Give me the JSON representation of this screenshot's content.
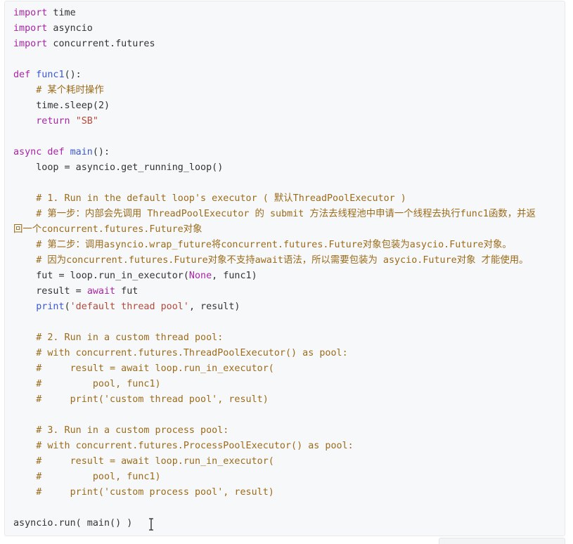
{
  "code": {
    "lines": [
      {
        "tokens": [
          {
            "t": "import",
            "c": "kw"
          },
          {
            "t": " time",
            "c": ""
          }
        ]
      },
      {
        "tokens": [
          {
            "t": "import",
            "c": "kw"
          },
          {
            "t": " asyncio",
            "c": ""
          }
        ]
      },
      {
        "tokens": [
          {
            "t": "import",
            "c": "kw"
          },
          {
            "t": " concurrent.futures",
            "c": ""
          }
        ]
      },
      {
        "tokens": []
      },
      {
        "tokens": [
          {
            "t": "def",
            "c": "kw"
          },
          {
            "t": " ",
            "c": ""
          },
          {
            "t": "func1",
            "c": "fn"
          },
          {
            "t": "():",
            "c": ""
          }
        ]
      },
      {
        "tokens": [
          {
            "t": "    ",
            "c": ""
          },
          {
            "t": "# 某个耗时操作",
            "c": "cmt"
          }
        ]
      },
      {
        "tokens": [
          {
            "t": "    time.sleep(",
            "c": ""
          },
          {
            "t": "2",
            "c": "num"
          },
          {
            "t": ")",
            "c": ""
          }
        ]
      },
      {
        "tokens": [
          {
            "t": "    ",
            "c": ""
          },
          {
            "t": "return",
            "c": "kw"
          },
          {
            "t": " ",
            "c": ""
          },
          {
            "t": "\"SB\"",
            "c": "str"
          }
        ]
      },
      {
        "tokens": []
      },
      {
        "tokens": [
          {
            "t": "async",
            "c": "kw"
          },
          {
            "t": " ",
            "c": ""
          },
          {
            "t": "def",
            "c": "kw"
          },
          {
            "t": " ",
            "c": ""
          },
          {
            "t": "main",
            "c": "fn"
          },
          {
            "t": "():",
            "c": ""
          }
        ]
      },
      {
        "tokens": [
          {
            "t": "    loop = asyncio.get_running_loop()",
            "c": ""
          }
        ]
      },
      {
        "tokens": []
      },
      {
        "tokens": [
          {
            "t": "    ",
            "c": ""
          },
          {
            "t": "# 1. Run in the default loop's executor ( 默认ThreadPoolExecutor )",
            "c": "cmt"
          }
        ]
      },
      {
        "tokens": [
          {
            "t": "    ",
            "c": ""
          },
          {
            "t": "# 第一步：内部会先调用 ThreadPoolExecutor 的 submit 方法去线程池中申请一个线程去执行func1函数，并返",
            "c": "cmt"
          }
        ]
      },
      {
        "tokens": [
          {
            "t": "回一个concurrent.futures.Future对象",
            "c": "cmt"
          }
        ]
      },
      {
        "tokens": [
          {
            "t": "    ",
            "c": ""
          },
          {
            "t": "# 第二步：调用asyncio.wrap_future将concurrent.futures.Future对象包装为asycio.Future对象。",
            "c": "cmt"
          }
        ]
      },
      {
        "tokens": [
          {
            "t": "    ",
            "c": ""
          },
          {
            "t": "# 因为concurrent.futures.Future对象不支持await语法，所以需要包装为 asycio.Future对象 才能使用。",
            "c": "cmt"
          }
        ]
      },
      {
        "tokens": [
          {
            "t": "    fut = loop.run_in_executor(",
            "c": ""
          },
          {
            "t": "None",
            "c": "none"
          },
          {
            "t": ", func1)",
            "c": ""
          }
        ]
      },
      {
        "tokens": [
          {
            "t": "    result = ",
            "c": ""
          },
          {
            "t": "await",
            "c": "kw"
          },
          {
            "t": " fut",
            "c": ""
          }
        ]
      },
      {
        "tokens": [
          {
            "t": "    ",
            "c": ""
          },
          {
            "t": "print",
            "c": "builtin"
          },
          {
            "t": "(",
            "c": ""
          },
          {
            "t": "'default thread pool'",
            "c": "str"
          },
          {
            "t": ", result)",
            "c": ""
          }
        ]
      },
      {
        "tokens": []
      },
      {
        "tokens": [
          {
            "t": "    ",
            "c": ""
          },
          {
            "t": "# 2. Run in a custom thread pool:",
            "c": "cmt"
          }
        ]
      },
      {
        "tokens": [
          {
            "t": "    ",
            "c": ""
          },
          {
            "t": "# with concurrent.futures.ThreadPoolExecutor() as pool:",
            "c": "cmt"
          }
        ]
      },
      {
        "tokens": [
          {
            "t": "    ",
            "c": ""
          },
          {
            "t": "#     result = await loop.run_in_executor(",
            "c": "cmt"
          }
        ]
      },
      {
        "tokens": [
          {
            "t": "    ",
            "c": ""
          },
          {
            "t": "#         pool, func1)",
            "c": "cmt"
          }
        ]
      },
      {
        "tokens": [
          {
            "t": "    ",
            "c": ""
          },
          {
            "t": "#     print('custom thread pool', result)",
            "c": "cmt"
          }
        ]
      },
      {
        "tokens": []
      },
      {
        "tokens": [
          {
            "t": "    ",
            "c": ""
          },
          {
            "t": "# 3. Run in a custom process pool:",
            "c": "cmt"
          }
        ]
      },
      {
        "tokens": [
          {
            "t": "    ",
            "c": ""
          },
          {
            "t": "# with concurrent.futures.ProcessPoolExecutor() as pool:",
            "c": "cmt"
          }
        ]
      },
      {
        "tokens": [
          {
            "t": "    ",
            "c": ""
          },
          {
            "t": "#     result = await loop.run_in_executor(",
            "c": "cmt"
          }
        ]
      },
      {
        "tokens": [
          {
            "t": "    ",
            "c": ""
          },
          {
            "t": "#         pool, func1)",
            "c": "cmt"
          }
        ]
      },
      {
        "tokens": [
          {
            "t": "    ",
            "c": ""
          },
          {
            "t": "#     print('custom process pool', result)",
            "c": "cmt"
          }
        ]
      },
      {
        "tokens": []
      },
      {
        "tokens": [
          {
            "t": "asyncio.run( main() )",
            "c": ""
          }
        ]
      }
    ]
  },
  "colors": {
    "keyword": "#a626a4",
    "function": "#3b57d4",
    "string": "#b3493a",
    "comment": "#9c6b1a",
    "text": "#333333",
    "panel_background": "#f7f8fa"
  },
  "icons": {
    "cursor": "text-cursor-icon"
  }
}
